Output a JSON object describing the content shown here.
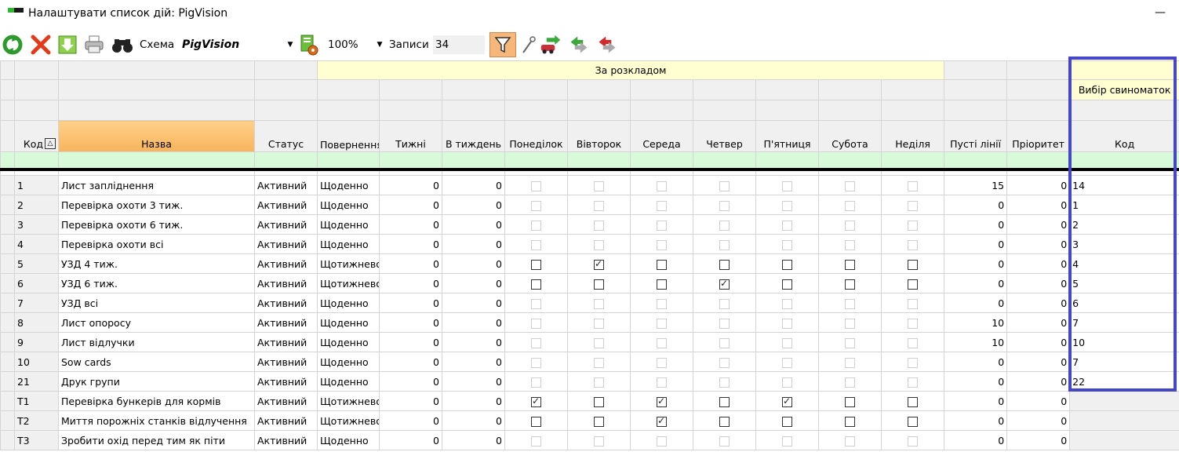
{
  "window": {
    "title": "Налаштувати список дій: PigVision",
    "minimize_glyph": "—"
  },
  "toolbar": {
    "scheme_label": "Схема",
    "scheme_value": "PigVision",
    "zoom_value": "100%",
    "records_label": "Записи",
    "records_value": "34",
    "icons": [
      "refresh-icon",
      "delete-icon",
      "download-icon",
      "print-icon",
      "binoculars-icon",
      "report-settings-icon",
      "filter-icon",
      "wrench-icon",
      "car-export-icon",
      "green-arrows-icon",
      "red-arrows-icon"
    ]
  },
  "grid": {
    "band_schedule": "За розкладом",
    "band_sows": "Вибір свиноматок",
    "columns": {
      "code": "Код",
      "sort_glyph": "△",
      "name": "Назва",
      "status": "Статус",
      "repeat": "Повернення",
      "weeks": "Тижні",
      "per_week": "В тиждень",
      "mon": "Понеділок",
      "tue": "Вівторок",
      "wed": "Середа",
      "thu": "Четвер",
      "fri": "П'ятниця",
      "sat": "Субота",
      "sun": "Неділя",
      "empty_lines": "Пусті лінії",
      "priority": "Пріоритет",
      "sow_code": "Код"
    },
    "rows": [
      {
        "code": "1",
        "name": "Лист запліднення",
        "status": "Активний",
        "repeat": "Щоденно",
        "weeks": "0",
        "per_week": "0",
        "days": [
          false,
          false,
          false,
          false,
          false,
          false,
          false
        ],
        "enabled": false,
        "empty_lines": "15",
        "priority": "0",
        "sow_code": "14"
      },
      {
        "code": "2",
        "name": "Перевірка охоти 3 тиж.",
        "status": "Активний",
        "repeat": "Щоденно",
        "weeks": "0",
        "per_week": "0",
        "days": [
          false,
          false,
          false,
          false,
          false,
          false,
          false
        ],
        "enabled": false,
        "empty_lines": "0",
        "priority": "0",
        "sow_code": "1"
      },
      {
        "code": "3",
        "name": "Перевірка охоти 6 тиж.",
        "status": "Активний",
        "repeat": "Щоденно",
        "weeks": "0",
        "per_week": "0",
        "days": [
          false,
          false,
          false,
          false,
          false,
          false,
          false
        ],
        "enabled": false,
        "empty_lines": "0",
        "priority": "0",
        "sow_code": "2"
      },
      {
        "code": "4",
        "name": "Перевірка охоти всі",
        "status": "Активний",
        "repeat": "Щоденно",
        "weeks": "0",
        "per_week": "0",
        "days": [
          false,
          false,
          false,
          false,
          false,
          false,
          false
        ],
        "enabled": false,
        "empty_lines": "0",
        "priority": "0",
        "sow_code": "3"
      },
      {
        "code": "5",
        "name": "УЗД 4 тиж.",
        "status": "Активний",
        "repeat": "Щотижнево",
        "weeks": "0",
        "per_week": "0",
        "days": [
          false,
          true,
          false,
          false,
          false,
          false,
          false
        ],
        "enabled": true,
        "empty_lines": "0",
        "priority": "0",
        "sow_code": "4"
      },
      {
        "code": "6",
        "name": "УЗД 6 тиж.",
        "status": "Активний",
        "repeat": "Щотижнево",
        "weeks": "0",
        "per_week": "0",
        "days": [
          false,
          false,
          false,
          true,
          false,
          false,
          false
        ],
        "enabled": true,
        "empty_lines": "0",
        "priority": "0",
        "sow_code": "5"
      },
      {
        "code": "7",
        "name": "УЗД всі",
        "status": "Активний",
        "repeat": "Щоденно",
        "weeks": "0",
        "per_week": "0",
        "days": [
          false,
          false,
          false,
          false,
          false,
          false,
          false
        ],
        "enabled": false,
        "empty_lines": "0",
        "priority": "0",
        "sow_code": "6"
      },
      {
        "code": "8",
        "name": "Лист опоросу",
        "status": "Активний",
        "repeat": "Щоденно",
        "weeks": "0",
        "per_week": "0",
        "days": [
          false,
          false,
          false,
          false,
          false,
          false,
          false
        ],
        "enabled": false,
        "empty_lines": "10",
        "priority": "0",
        "sow_code": "7"
      },
      {
        "code": "9",
        "name": "Лист відлучки",
        "status": "Активний",
        "repeat": "Щоденно",
        "weeks": "0",
        "per_week": "0",
        "days": [
          false,
          false,
          false,
          false,
          false,
          false,
          false
        ],
        "enabled": false,
        "empty_lines": "10",
        "priority": "0",
        "sow_code": "10"
      },
      {
        "code": "10",
        "name": "Sow cards",
        "status": "Активний",
        "repeat": "Щоденно",
        "weeks": "0",
        "per_week": "0",
        "days": [
          false,
          false,
          false,
          false,
          false,
          false,
          false
        ],
        "enabled": false,
        "empty_lines": "0",
        "priority": "0",
        "sow_code": "7"
      },
      {
        "code": "21",
        "name": "Друк групи",
        "status": "Активний",
        "repeat": "Щоденно",
        "weeks": "0",
        "per_week": "0",
        "days": [
          false,
          false,
          false,
          false,
          false,
          false,
          false
        ],
        "enabled": false,
        "empty_lines": "0",
        "priority": "0",
        "sow_code": "22"
      },
      {
        "code": "T1",
        "name": "Перевірка бункерів для кормів",
        "status": "Активний",
        "repeat": "Щотижнево",
        "weeks": "0",
        "per_week": "0",
        "days": [
          true,
          false,
          true,
          false,
          true,
          false,
          false
        ],
        "enabled": true,
        "empty_lines": "0",
        "priority": "0",
        "sow_code": ""
      },
      {
        "code": "T2",
        "name": "Миття порожніх станків відлучення",
        "status": "Активний",
        "repeat": "Щотижнево",
        "weeks": "0",
        "per_week": "0",
        "days": [
          false,
          false,
          true,
          false,
          false,
          false,
          false
        ],
        "enabled": true,
        "empty_lines": "0",
        "priority": "0",
        "sow_code": ""
      },
      {
        "code": "T3",
        "name": "Зробити охід перед тим як піти",
        "status": "Активний",
        "repeat": "Щоденно",
        "weeks": "0",
        "per_week": "0",
        "days": [
          false,
          false,
          false,
          false,
          false,
          false,
          false
        ],
        "enabled": false,
        "empty_lines": "0",
        "priority": "0",
        "sow_code": ""
      }
    ]
  }
}
